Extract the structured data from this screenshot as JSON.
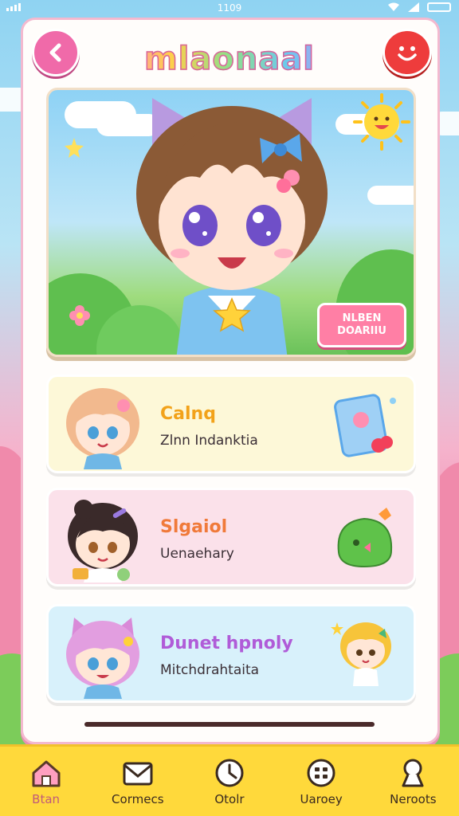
{
  "status_bar": {
    "time": "1109"
  },
  "header": {
    "title": "mlaonaal"
  },
  "hero": {
    "badge_line1": "NLBEN",
    "badge_line2": "DOARIIU"
  },
  "characters": [
    {
      "name": "Calnq",
      "desc": "Zlnn Indanktia",
      "name_color": "#f2a21a",
      "bg": "#fdf8d8"
    },
    {
      "name": "Slgaiol",
      "desc": "Uenaehary",
      "name_color": "#f07a3a",
      "bg": "#fbe1ea"
    },
    {
      "name": "Dunet hpnoly",
      "desc": "Mitchdrahtaita",
      "name_color": "#b05cd8",
      "bg": "#d8f1fb"
    }
  ],
  "tabs": [
    {
      "label": "Btan",
      "icon": "house-icon",
      "active": true
    },
    {
      "label": "Cormecs",
      "icon": "mail-icon",
      "active": false
    },
    {
      "label": "Otolr",
      "icon": "clock-icon",
      "active": false
    },
    {
      "label": "Uaroey",
      "icon": "grid-icon",
      "active": false
    },
    {
      "label": "Neroots",
      "icon": "person-icon",
      "active": false
    }
  ]
}
